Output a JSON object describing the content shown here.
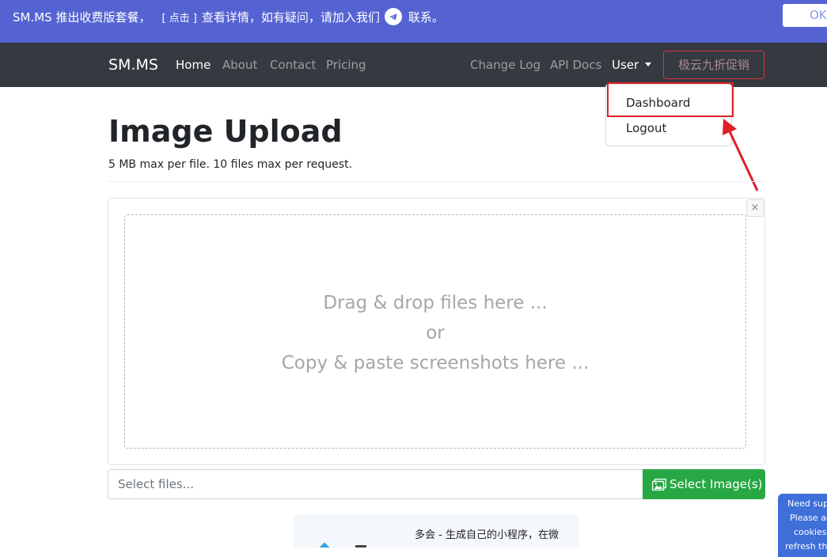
{
  "announcement": {
    "text_before": "SM.MS 推出收费版套餐，",
    "link_text": "[ 点击 ]",
    "text_after": "查看详情，如有疑问，请加入我们",
    "text_end": "联系。",
    "ok_button": "OK"
  },
  "navbar": {
    "brand": "SM.MS",
    "links": [
      "Home",
      "About",
      "Contact",
      "Pricing"
    ],
    "right_links": [
      "Change Log",
      "API Docs"
    ],
    "user_label": "User",
    "promo_label": "极云九折促销"
  },
  "dropdown": {
    "items": [
      "Dashboard",
      "Logout"
    ]
  },
  "page": {
    "title": "Image Upload",
    "subtitle": "5 MB max per file. 10 files max per request."
  },
  "dropzone": {
    "line1": "Drag & drop files here ...",
    "line2": "or",
    "line3": "Copy & paste screenshots here ...",
    "close_glyph": "×"
  },
  "file_input": {
    "placeholder": "Select files...",
    "button_label": "Select Image(s)"
  },
  "ad": {
    "text": "多会 - 生成自己的小程序，在微"
  },
  "cookie": {
    "lines": [
      "Need sup",
      "Please ac",
      "cookies a",
      "refresh the"
    ]
  },
  "colors": {
    "announcement_bg": "#5563d2",
    "navbar_bg": "#343a40",
    "accent_green": "#28a745",
    "highlight_red": "#dd1f2a",
    "cookie_bg": "#3f6fd8"
  },
  "icons": [
    "telegram-icon",
    "caret-down-icon",
    "close-icon",
    "images-icon"
  ]
}
